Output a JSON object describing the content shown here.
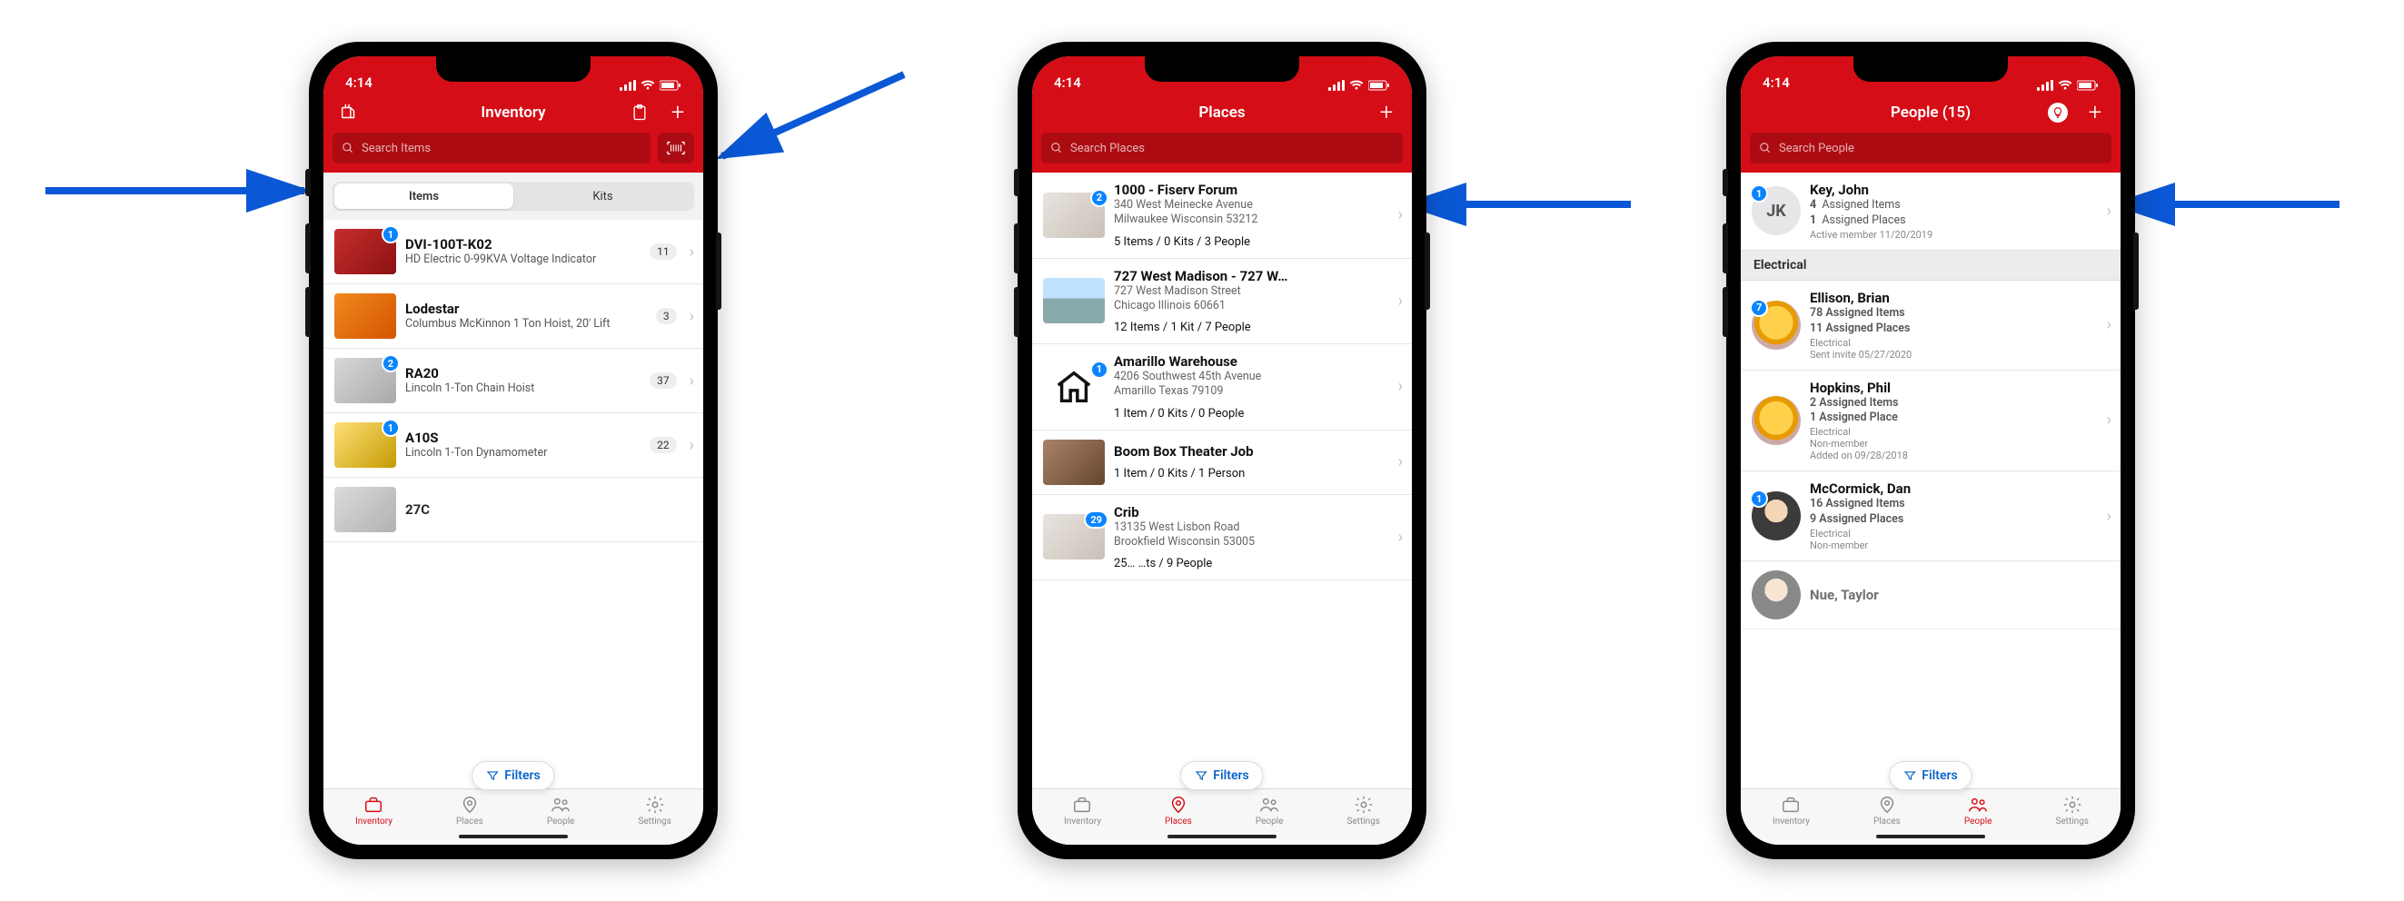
{
  "status": {
    "time": "4:14"
  },
  "tabs": {
    "inventory": "Inventory",
    "places": "Places",
    "people": "People",
    "settings": "Settings"
  },
  "filters_label": "Filters",
  "inventory": {
    "title": "Inventory",
    "search_placeholder": "Search Items",
    "segments": {
      "items": "Items",
      "kits": "Kits"
    },
    "rows": [
      {
        "badge": "1",
        "title": "DVI-100T-K02",
        "sub": "HD Electric 0-99KVA Voltage Indicator",
        "count": "11"
      },
      {
        "badge": "",
        "title": "Lodestar",
        "sub": "Columbus McKinnon 1 Ton Hoist, 20' Lift",
        "count": "3"
      },
      {
        "badge": "2",
        "title": "RA20",
        "sub": "Lincoln 1-Ton Chain Hoist",
        "count": "37"
      },
      {
        "badge": "1",
        "title": "A10S",
        "sub": "Lincoln 1-Ton Dynamometer",
        "count": "22"
      }
    ],
    "peek_title": "27C"
  },
  "places": {
    "title": "Places",
    "search_placeholder": "Search Places",
    "rows": [
      {
        "badge": "2",
        "title": "1000 - Fiserv Forum",
        "line1": "340 West Meinecke Avenue",
        "line2": "Milwaukee Wisconsin 53212",
        "meta": "5 Items / 0 Kits / 3 People"
      },
      {
        "badge": "",
        "title": "727 West Madison - 727 W…",
        "line1": "727 West Madison Street",
        "line2": "Chicago Illinois 60661",
        "meta": "12 Items / 1 Kit / 7 People"
      },
      {
        "badge": "1",
        "title": "Amarillo Warehouse",
        "line1": "4206 Southwest 45th Avenue",
        "line2": "Amarillo Texas 79109",
        "meta": "1 Item / 0 Kits / 0 People"
      },
      {
        "badge": "",
        "title": "Boom Box Theater Job",
        "line1": "",
        "line2": "",
        "meta": "1 Item / 0 Kits / 1 Person"
      },
      {
        "badge": "29",
        "title": "Crib",
        "line1": "13135 West Lisbon Road",
        "line2": "Brookfield Wisconsin 53005",
        "meta": "25…  …ts / 9 People"
      }
    ]
  },
  "people": {
    "title": "People (15)",
    "search_placeholder": "Search People",
    "top": {
      "badge": "1",
      "initials": "JK",
      "name": "Key, John",
      "l1_n": "4",
      "l1": "Assigned Items",
      "l2_n": "1",
      "l2": "Assigned Places",
      "l3": "Active member 11/20/2019"
    },
    "section": "Electrical",
    "rows": [
      {
        "badge": "7",
        "name": "Ellison, Brian",
        "l1": "78 Assigned Items",
        "l2": "11 Assigned Places",
        "l3": "Electrical",
        "l4": "Sent invite 05/27/2020"
      },
      {
        "badge": "",
        "name": "Hopkins, Phil",
        "l1": "2 Assigned Items",
        "l2": "1 Assigned Place",
        "l3": "Electrical",
        "l4": "Non-member",
        "l5": "Added on 09/28/2018"
      },
      {
        "badge": "1",
        "name": "McCormick, Dan",
        "l1": "16 Assigned Items",
        "l2": "9 Assigned Places",
        "l3": "Electrical",
        "l4": "Non-member"
      }
    ],
    "peek_name": "Nue, Taylor"
  }
}
